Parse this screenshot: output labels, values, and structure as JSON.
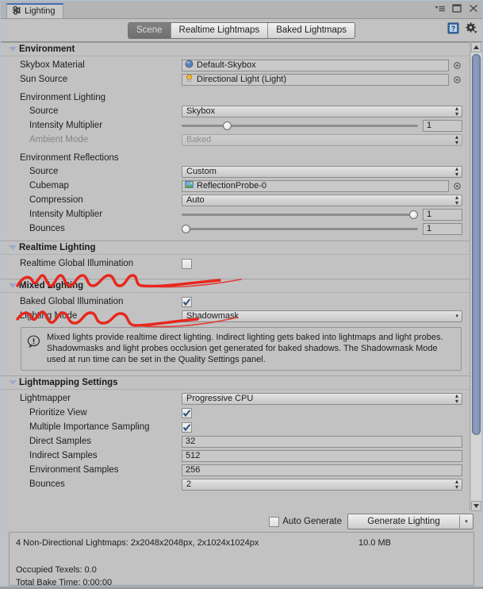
{
  "window": {
    "tab_title": "Lighting",
    "tab_icon": "lighting-settings-icon",
    "menu_icon": "window-menu-icon",
    "maximize_icon": "maximize-icon",
    "close_icon": "close-icon"
  },
  "toolbar": {
    "tabs": [
      {
        "label": "Scene",
        "active": true
      },
      {
        "label": "Realtime Lightmaps",
        "active": false
      },
      {
        "label": "Baked Lightmaps",
        "active": false
      }
    ],
    "help_icon": "help-book-icon",
    "settings_icon": "gear-icon"
  },
  "environment": {
    "title": "Environment",
    "skybox_material": {
      "label": "Skybox Material",
      "value": "Default-Skybox",
      "icon": "material-sphere-icon",
      "picker": "object-picker-icon"
    },
    "sun_source": {
      "label": "Sun Source",
      "value": "Directional Light (Light)",
      "icon": "light-bulb-icon",
      "picker": "object-picker-icon"
    },
    "env_lighting_group": "Environment Lighting",
    "env_lighting_source": {
      "label": "Source",
      "value": "Skybox"
    },
    "env_lighting_intensity": {
      "label": "Intensity Multiplier",
      "value": "1",
      "slider_pct": 18
    },
    "ambient_mode": {
      "label": "Ambient Mode",
      "value": "Baked",
      "disabled": true
    },
    "env_reflections_group": "Environment Reflections",
    "refl_source": {
      "label": "Source",
      "value": "Custom"
    },
    "refl_cubemap": {
      "label": "Cubemap",
      "value": "ReflectionProbe-0",
      "icon": "cubemap-icon",
      "picker": "object-picker-icon"
    },
    "refl_compression": {
      "label": "Compression",
      "value": "Auto"
    },
    "refl_intensity": {
      "label": "Intensity Multiplier",
      "value": "1",
      "slider_pct": 100
    },
    "refl_bounces": {
      "label": "Bounces",
      "value": "1",
      "slider_pct": 0
    }
  },
  "realtime_lighting": {
    "title": "Realtime Lighting",
    "realtime_gi": {
      "label": "Realtime Global Illumination",
      "checked": false
    }
  },
  "mixed_lighting": {
    "title": "Mixed Lighting",
    "baked_gi": {
      "label": "Baked Global Illumination",
      "checked": true
    },
    "lighting_mode": {
      "label": "Lighting Mode",
      "value": "Shadowmask"
    },
    "info_icon": "info-exclamation-icon",
    "info_text": "Mixed lights provide realtime direct lighting. Indirect lighting gets baked into lightmaps and light probes. Shadowmasks and light probes occlusion get generated for baked shadows. The Shadowmask Mode used at run time can be set in the Quality Settings panel."
  },
  "lightmapping_settings": {
    "title": "Lightmapping Settings",
    "lightmapper": {
      "label": "Lightmapper",
      "value": "Progressive CPU"
    },
    "prioritize_view": {
      "label": "Prioritize View",
      "checked": true
    },
    "multiple_importance_sampling": {
      "label": "Multiple Importance Sampling",
      "checked": true
    },
    "direct_samples": {
      "label": "Direct Samples",
      "value": "32"
    },
    "indirect_samples": {
      "label": "Indirect Samples",
      "value": "512"
    },
    "environment_samples": {
      "label": "Environment Samples",
      "value": "256"
    },
    "bounces": {
      "label": "Bounces",
      "value": "2"
    }
  },
  "bottom": {
    "auto_generate": {
      "label": "Auto Generate",
      "checked": false
    },
    "generate_button": "Generate Lighting",
    "generate_dropdown_icon": "chevron-down-icon",
    "stats": {
      "lightmaps": "4 Non-Directional Lightmaps: 2x2048x2048px, 2x1024x1024px",
      "size": "10.0 MB",
      "occupied_texels": "Occupied Texels: 0.0",
      "total_bake_time": "Total Bake Time: 0:00:00"
    }
  },
  "annotations": {
    "scribble_color": "#e8261c",
    "scribble_1_target": "realtime-global-illumination",
    "scribble_2_target": "baked-global-illumination"
  },
  "scrollbar": {
    "up_icon": "caret-up-icon",
    "down_icon": "caret-down-icon"
  }
}
